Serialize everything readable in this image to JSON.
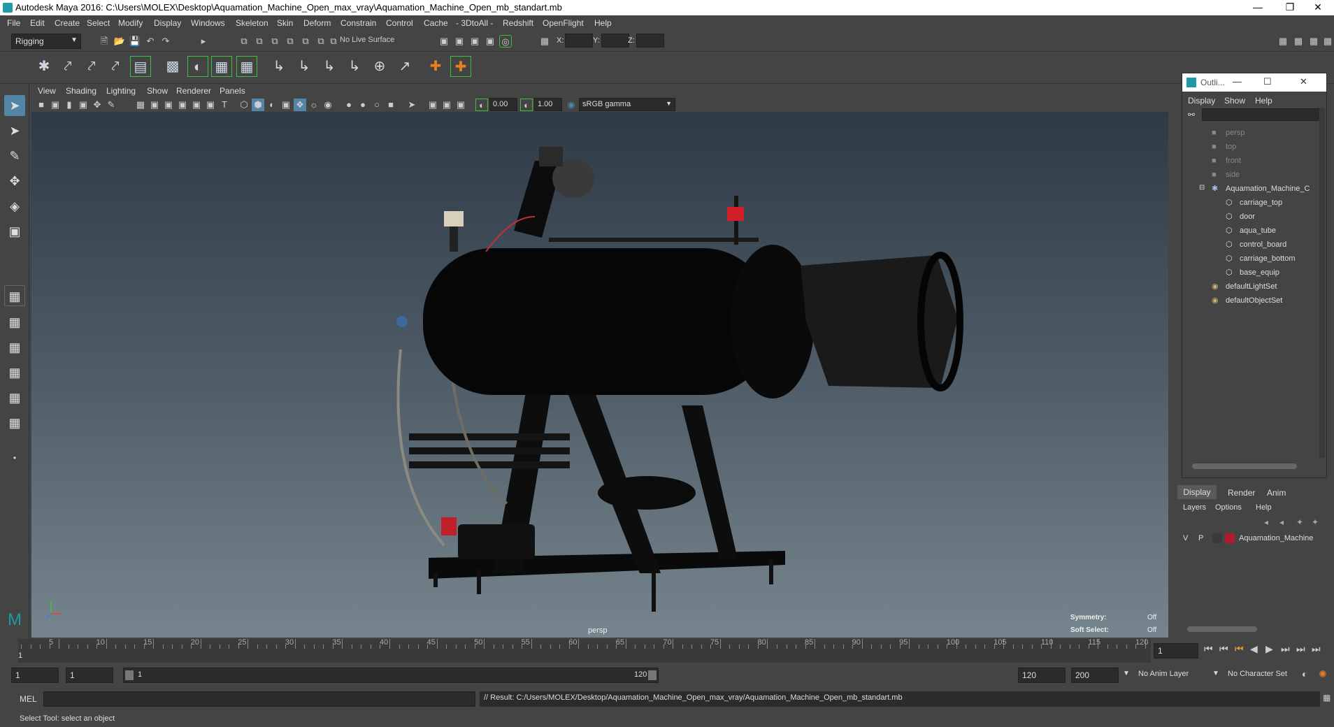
{
  "window": {
    "title": "Autodesk Maya 2016: C:\\Users\\MOLEX\\Desktop\\Aquamation_Machine_Open_max_vray\\Aquamation_Machine_Open_mb_standart.mb"
  },
  "menubar": [
    "File",
    "Edit",
    "Create",
    "Select",
    "Modify",
    "Display",
    "Windows",
    "Skeleton",
    "Skin",
    "Deform",
    "Constrain",
    "Control",
    "Cache",
    "- 3DtoAll -",
    "Redshift",
    "OpenFlight",
    "Help"
  ],
  "statusline": {
    "mode": "Rigging",
    "live_surface": "No Live Surface",
    "x_label": "X:",
    "y_label": "Y:",
    "z_label": "Z:"
  },
  "viewport": {
    "menus": [
      "View",
      "Shading",
      "Lighting",
      "Show",
      "Renderer",
      "Panels"
    ],
    "exposure": "0.00",
    "gamma": "1.00",
    "color_space": "sRGB gamma",
    "camera_label": "persp",
    "symmetry_label": "Symmetry:",
    "symmetry_value": "Off",
    "soft_select_label": "Soft Select:",
    "soft_select_value": "Off"
  },
  "outliner": {
    "title": "Outli...",
    "menus": [
      "Display",
      "Show",
      "Help"
    ],
    "items": [
      {
        "label": "persp",
        "indent": 2,
        "icon": "camera-icon",
        "dim": true
      },
      {
        "label": "top",
        "indent": 2,
        "icon": "camera-icon",
        "dim": true
      },
      {
        "label": "front",
        "indent": 2,
        "icon": "camera-icon",
        "dim": true
      },
      {
        "label": "side",
        "indent": 2,
        "icon": "camera-icon",
        "dim": true
      },
      {
        "label": "Aquamation_Machine_C",
        "indent": 2,
        "icon": "group-icon",
        "dim": false
      },
      {
        "label": "carriage_top",
        "indent": 3,
        "icon": "mesh-icon",
        "dim": false
      },
      {
        "label": "door",
        "indent": 3,
        "icon": "mesh-icon",
        "dim": false
      },
      {
        "label": "aqua_tube",
        "indent": 3,
        "icon": "mesh-icon",
        "dim": false
      },
      {
        "label": "control_board",
        "indent": 3,
        "icon": "mesh-icon",
        "dim": false
      },
      {
        "label": "carriage_bottom",
        "indent": 3,
        "icon": "mesh-icon",
        "dim": false
      },
      {
        "label": "base_equip",
        "indent": 3,
        "icon": "mesh-icon",
        "dim": false
      },
      {
        "label": "defaultLightSet",
        "indent": 2,
        "icon": "set-icon",
        "dim": false
      },
      {
        "label": "defaultObjectSet",
        "indent": 2,
        "icon": "set-icon",
        "dim": false
      }
    ]
  },
  "layers": {
    "tabs": [
      "Display",
      "Render",
      "Anim"
    ],
    "menus": [
      "Layers",
      "Options",
      "Help"
    ],
    "layer": {
      "v": "V",
      "p": "P",
      "name": "Aquamation_Machine",
      "color": "#b01c2e"
    }
  },
  "timeline": {
    "ticks": [
      "5",
      "10",
      "15",
      "20",
      "25",
      "30",
      "35",
      "40",
      "45",
      "50",
      "55",
      "60",
      "65",
      "70",
      "75",
      "80",
      "85",
      "90",
      "95",
      "100",
      "105",
      "110",
      "115",
      "120"
    ],
    "current_frame": "1",
    "current_field": "1"
  },
  "range": {
    "start": "1",
    "playback_start": "1",
    "slider_start": "1",
    "slider_end": "120",
    "playback_end": "120",
    "end": "200",
    "anim_layer": "No Anim Layer",
    "char_set": "No Character Set"
  },
  "cmdline": {
    "lang": "MEL",
    "result": "// Result: C:/Users/MOLEX/Desktop/Aquamation_Machine_Open_max_vray/Aquamation_Machine_Open_mb_standart.mb"
  },
  "helpline": "Select Tool: select an object",
  "colors": {
    "accent": "#5285a6",
    "highlight": "#1f9aa8",
    "green_outline": "#3fbf3f"
  }
}
